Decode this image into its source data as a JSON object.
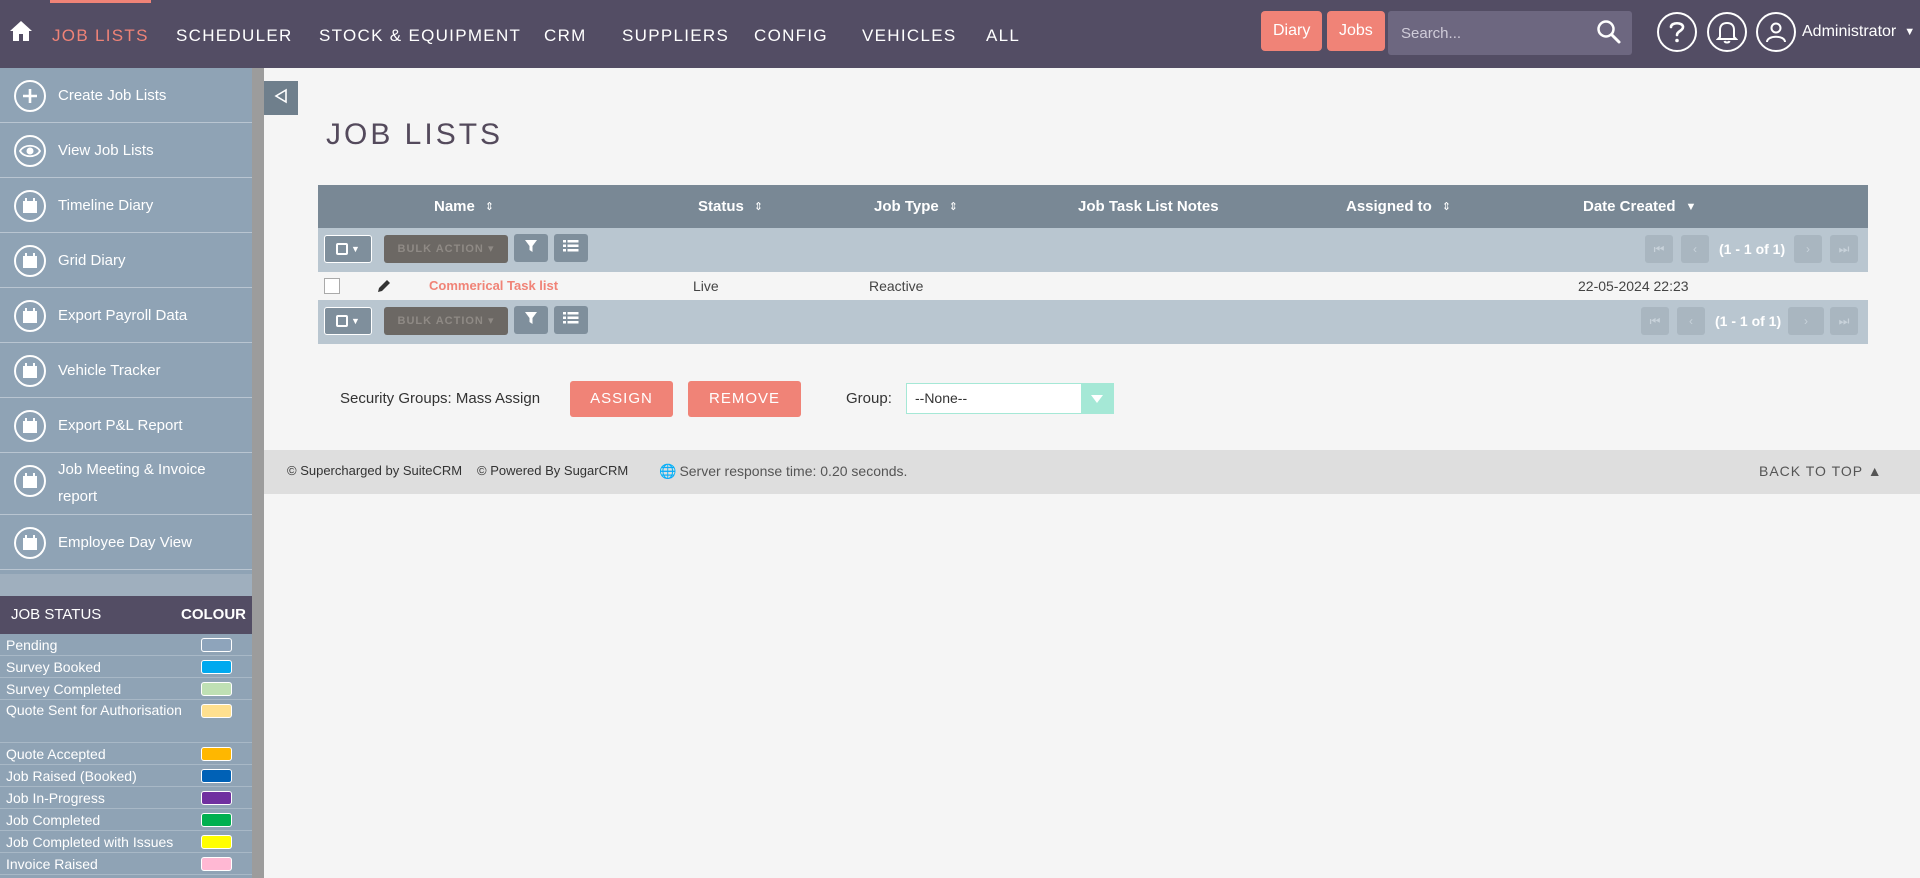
{
  "nav": {
    "items": [
      "JOB LISTS",
      "SCHEDULER",
      "STOCK & EQUIPMENT",
      "CRM",
      "SUPPLIERS",
      "CONFIG",
      "VEHICLES",
      "ALL"
    ],
    "quick": [
      "Diary",
      "Jobs"
    ],
    "search_placeholder": "Search...",
    "user": "Administrator"
  },
  "sidebar": {
    "items": [
      "Create Job Lists",
      "View Job Lists",
      "Timeline Diary",
      "Grid Diary",
      "Export Payroll Data",
      "Vehicle Tracker",
      "Export P&L Report",
      "Job Meeting & Invoice report",
      "Employee Day View"
    ],
    "status_header": "JOB STATUS",
    "colour_header": "COLOUR",
    "statuses": [
      {
        "label": "Pending",
        "color": "#8ea4bb"
      },
      {
        "label": "Survey Booked",
        "color": "#00a9ef"
      },
      {
        "label": "Survey Completed",
        "color": "#bfe0b4"
      },
      {
        "label": "Quote Sent for Authorisation",
        "color": "#ffe08f"
      },
      {
        "label": "Quote Accepted",
        "color": "#ffb700"
      },
      {
        "label": "Job Raised (Booked)",
        "color": "#0061b6"
      },
      {
        "label": "Job In-Progress",
        "color": "#7030a0"
      },
      {
        "label": "Job Completed",
        "color": "#00b050"
      },
      {
        "label": "Job Completed with Issues",
        "color": "#ffff00"
      },
      {
        "label": "Invoice Raised",
        "color": "#ffb8d3"
      }
    ]
  },
  "page": {
    "title": "JOB LISTS"
  },
  "table": {
    "headers": [
      "Name",
      "Status",
      "Job Type",
      "Job Task List Notes",
      "Assigned to",
      "Date Created"
    ],
    "bulk_action": "BULK ACTION",
    "pagination": "(1 - 1 of 1)",
    "rows": [
      {
        "name": "Commerical Task list",
        "status": "Live",
        "job_type": "Reactive",
        "notes": "",
        "assigned": "",
        "date": "22-05-2024 22:23"
      }
    ]
  },
  "security": {
    "label": "Security Groups: Mass Assign",
    "assign": "ASSIGN",
    "remove": "REMOVE",
    "group_label": "Group:",
    "group_value": "--None--"
  },
  "footer": {
    "supercharged": "© Supercharged by SuiteCRM",
    "powered": "© Powered By SugarCRM",
    "response": "Server response time: 0.20 seconds.",
    "back_to_top": "BACK TO TOP"
  },
  "colors": {
    "accent": "#f08377",
    "nav_bg": "#534d64",
    "sidebar_bg": "#8fa3b5",
    "table_head": "#798895"
  }
}
